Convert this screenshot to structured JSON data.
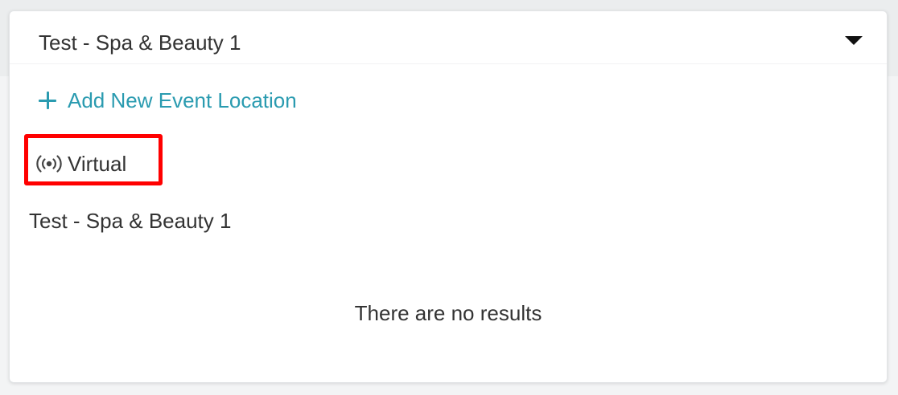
{
  "select": {
    "value": "Test - Spa & Beauty 1",
    "caret_icon": "caret-down-icon"
  },
  "menu": {
    "add_new_label": "Add New Event Location",
    "add_icon": "plus-icon",
    "options": [
      {
        "label": "Virtual",
        "icon": "broadcast-icon",
        "highlighted": true
      },
      {
        "label": "Test - Spa & Beauty 1"
      }
    ],
    "empty_message": "There are no results"
  },
  "colors": {
    "accent": "#2a9bb0",
    "highlight": "#ff0000",
    "text": "#333333"
  }
}
